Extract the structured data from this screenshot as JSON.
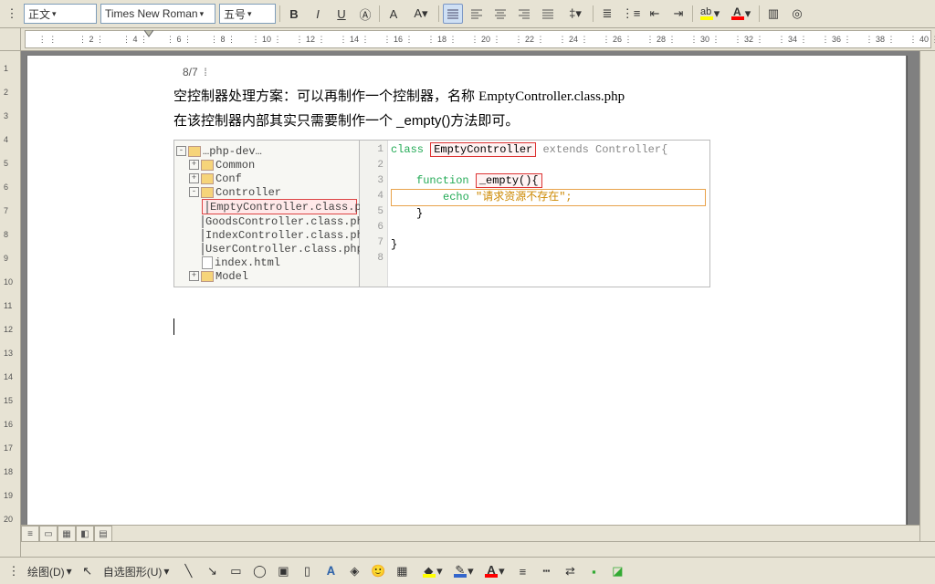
{
  "toolbar": {
    "style_label": "正文",
    "font_label": "Times New Roman",
    "size_label": "五号",
    "bold": "B",
    "italic": "I",
    "underline": "U"
  },
  "ruler": {
    "ticks": [
      "",
      "2",
      "4",
      "6",
      "8",
      "10",
      "12",
      "14",
      "16",
      "18",
      "20",
      "22",
      "24",
      "26",
      "28",
      "30",
      "32",
      "34",
      "36",
      "38",
      "40"
    ]
  },
  "doc": {
    "page_header": "8/7",
    "line1_a": "空控制器处理方案：可以再制作一个控制器，名称 ",
    "line1_b": "EmptyController.class.php",
    "line2": "在该控制器内部其实只需要制作一个 _empty()方法即可。"
  },
  "ide": {
    "tree": {
      "root": "…php-dev…",
      "items": [
        "Common",
        "Conf",
        "Controller"
      ],
      "files": [
        "EmptyController.class.php",
        "GoodsController.class.php",
        "IndexController.class.php",
        "UserController.class.php",
        "index.html"
      ],
      "tail": "Model"
    },
    "code": {
      "l1_kw": "class",
      "l1_name": "EmptyController",
      "l1_tail": " extends Controller{",
      "l3_kw": "function",
      "l3_name": "_empty(){",
      "l4_kw": "echo",
      "l4_str": "\"请求资源不存在\";",
      "gutter": [
        "1",
        "2",
        "3",
        "4",
        "5",
        "6",
        "7",
        "8"
      ]
    }
  },
  "drawbar": {
    "draw_label": "绘图(D)",
    "autoshape_label": "自选图形(U)"
  }
}
